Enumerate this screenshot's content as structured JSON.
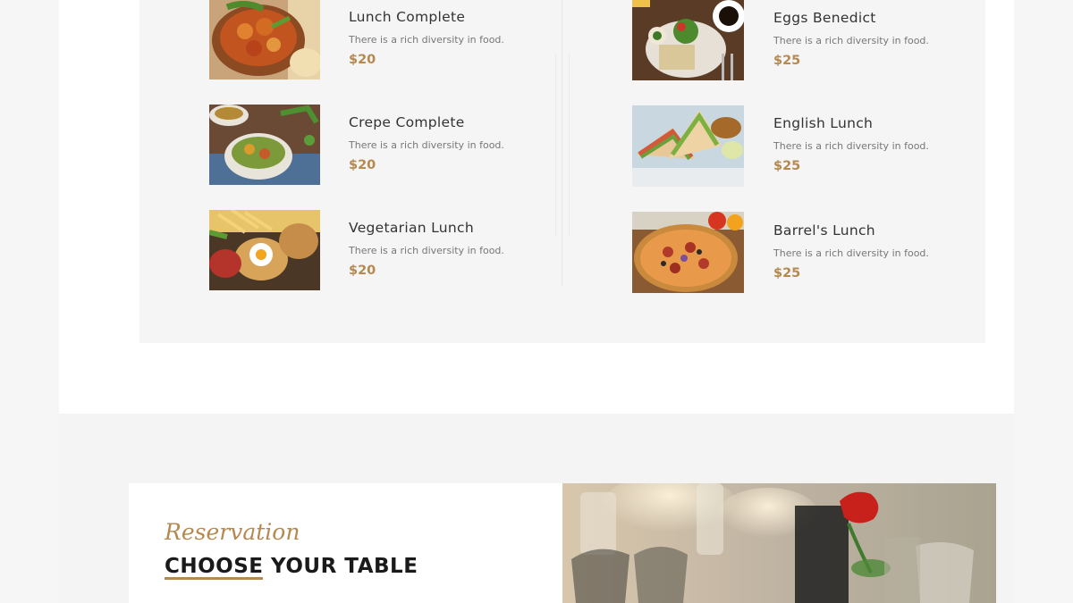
{
  "menu": {
    "left": [
      {
        "name": "Lunch Complete",
        "desc": "There is a rich diversity in food.",
        "price": "$20"
      },
      {
        "name": "Crepe Complete",
        "desc": "There is a rich diversity in food.",
        "price": "$20"
      },
      {
        "name": "Vegetarian Lunch",
        "desc": "There is a rich diversity in food.",
        "price": "$20"
      }
    ],
    "right": [
      {
        "name": "Eggs Benedict",
        "desc": "There is a rich diversity in food.",
        "price": "$25"
      },
      {
        "name": "English Lunch",
        "desc": "There is a rich diversity in food.",
        "price": "$25"
      },
      {
        "name": "Barrel's Lunch",
        "desc": "There is a rich diversity in food.",
        "price": "$25"
      }
    ]
  },
  "reservation": {
    "script_label": "Reservation",
    "heading": "CHOOSE YOUR TABLE"
  },
  "colors": {
    "accent": "#b5894f",
    "panel": "#f5f5f5",
    "text": "#333333"
  }
}
